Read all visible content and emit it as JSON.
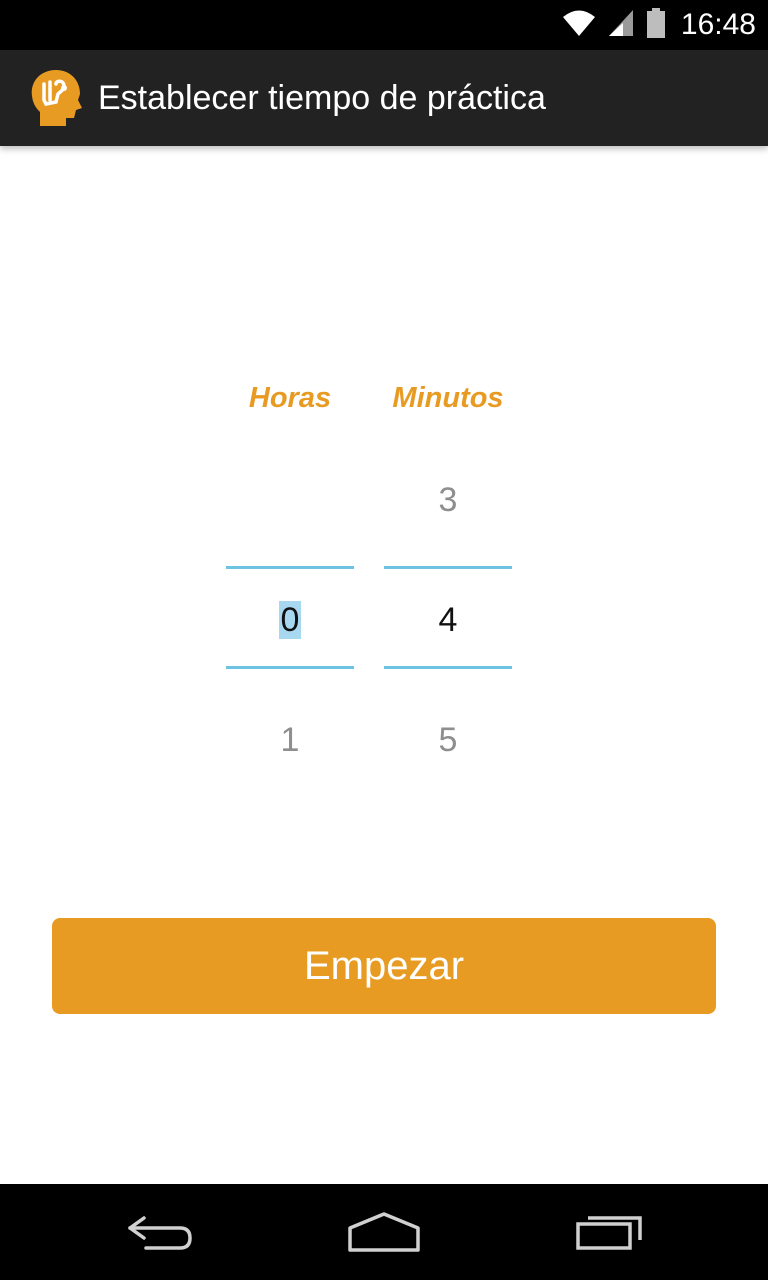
{
  "status_bar": {
    "time": "16:48",
    "icons": [
      "wifi-icon",
      "signal-icon",
      "battery-icon"
    ]
  },
  "action_bar": {
    "app_icon": "brain-hand-logo",
    "title": "Establecer tiempo de práctica"
  },
  "picker": {
    "hours": {
      "label": "Horas",
      "previous": "",
      "current": "0",
      "next": "1"
    },
    "minutes": {
      "label": "Minutos",
      "previous": "3",
      "current": "4",
      "next": "5"
    }
  },
  "start_button": {
    "label": "Empezar"
  },
  "nav_bar": {
    "icons": [
      "back-icon",
      "home-icon",
      "recent-apps-icon"
    ]
  },
  "colors": {
    "accent": "#E89B22",
    "picker_divider": "#6EC3E3",
    "selection_highlight": "#A8D8F0",
    "action_bar": "#222222"
  }
}
